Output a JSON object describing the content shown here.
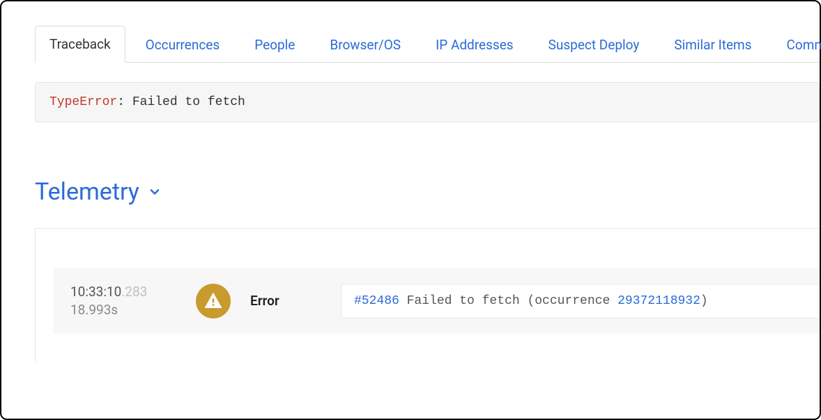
{
  "tabs": [
    {
      "label": "Traceback",
      "active": true
    },
    {
      "label": "Occurrences",
      "active": false
    },
    {
      "label": "People",
      "active": false
    },
    {
      "label": "Browser/OS",
      "active": false
    },
    {
      "label": "IP Addresses",
      "active": false
    },
    {
      "label": "Suspect Deploy",
      "active": false
    },
    {
      "label": "Similar Items",
      "active": false
    },
    {
      "label": "Community",
      "active": false
    }
  ],
  "error": {
    "type": "TypeError",
    "separator": ": ",
    "message": "Failed to fetch"
  },
  "telemetry": {
    "heading": "Telemetry",
    "events": [
      {
        "time_main": "10:33:10",
        "time_ms": ".283",
        "duration": "18.993s",
        "type": "Error",
        "msg_id": "#52486",
        "msg_text_1": " Failed to fetch (occurrence ",
        "msg_occurrence": "29372118932",
        "msg_text_2": ")"
      }
    ]
  }
}
